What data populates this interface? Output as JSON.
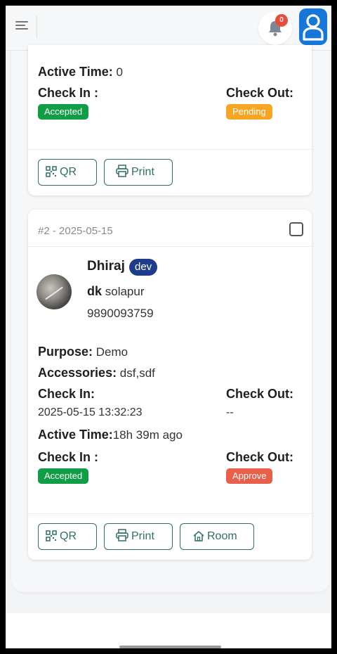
{
  "topbar": {
    "notification_count": "0"
  },
  "card1": {
    "active_time_label": "Active Time:",
    "active_time_value": " 0",
    "check_in_status_label": "Check In :",
    "check_out_status_label": "Check Out:",
    "check_in_status": "Accepted",
    "check_out_status": "Pending",
    "buttons": {
      "qr": "QR",
      "print": "Print"
    }
  },
  "card2": {
    "header": "#2 - 2025-05-15",
    "name": "Dhiraj",
    "role": "dev",
    "company_bold": "dk",
    "company_rest": " solapur",
    "phone": "9890093759",
    "purpose_label": "Purpose:",
    "purpose_value": " Demo",
    "accessories_label": "Accessories:",
    "accessories_value": " dsf,sdf",
    "check_in_label": "Check In:",
    "check_out_label": "Check Out:",
    "check_in_value": "2025-05-15 13:32:23",
    "check_out_value": "--",
    "active_time_label": "Active Time:",
    "active_time_value": "18h 39m ago",
    "check_in_status_label": "Check In :",
    "check_out_status_label": "Check Out:",
    "check_in_status": "Accepted",
    "check_out_status": "Approve",
    "buttons": {
      "qr": "QR",
      "print": "Print",
      "room": "Room"
    }
  },
  "colors": {
    "accepted": "#0f9d45",
    "pending": "#f6a623",
    "approve": "#e8604a",
    "role_badge": "#1d3c8c",
    "button_border": "#2d6f63",
    "avatar_button": "#1677d9"
  }
}
